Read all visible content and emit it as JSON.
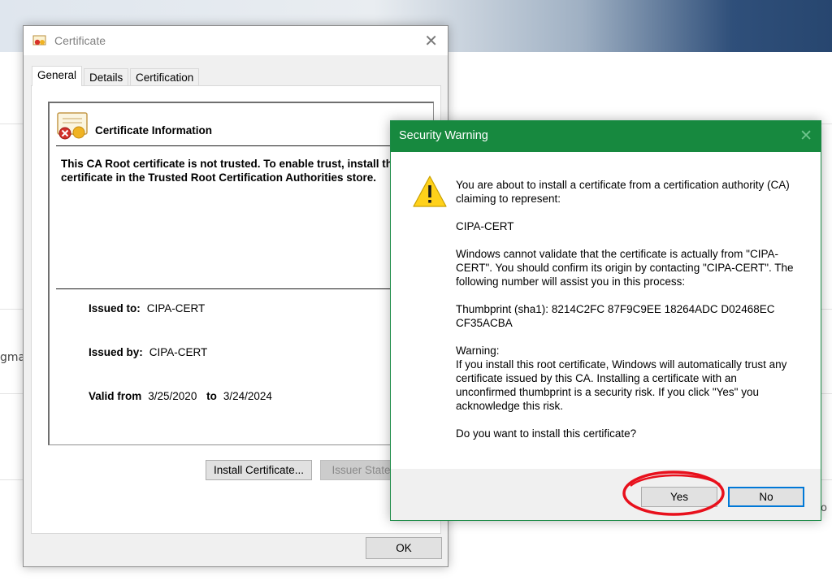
{
  "background": {
    "partial_text_left": "gma",
    "partial_text_right": "o"
  },
  "certificate_window": {
    "title": "Certificate",
    "close_glyph": "✕",
    "tabs": [
      {
        "label": "General",
        "active": true
      },
      {
        "label": "Details",
        "active": false
      },
      {
        "label": "Certification Path",
        "active": false
      }
    ],
    "info_heading": "Certificate Information",
    "message": "This CA Root certificate is not trusted. To enable trust, install this certificate in the Trusted Root Certification Authorities store.",
    "issued_to_label": "Issued to:",
    "issued_to_value": "CIPA-CERT",
    "issued_by_label": "Issued by:",
    "issued_by_value": "CIPA-CERT",
    "valid_from_label": "Valid from",
    "valid_from_value": "3/25/2020",
    "valid_to_label": "to",
    "valid_to_value": "3/24/2024",
    "install_button": "Install Certificate...",
    "issuer_statement_button": "Issuer Statement",
    "ok_button": "OK",
    "icons": {
      "title": "certificate-icon",
      "info": "untrusted-certificate-icon"
    }
  },
  "security_warning": {
    "title": "Security Warning",
    "close_glyph": "✕",
    "icon": "warning-icon",
    "intro": "You are about to install a certificate from a certification authority (CA) claiming to represent:",
    "ca_name": "CIPA-CERT",
    "validation_text": "Windows cannot validate that the certificate is actually from \"CIPA-CERT\". You should confirm its origin by contacting \"CIPA-CERT\". The following number will assist you in this process:",
    "thumbprint_label": "Thumbprint (sha1):",
    "thumbprint_value": "8214C2FC 87F9C9EE 18264ADC D02468EC CF35ACBA",
    "warning_label": "Warning:",
    "warning_text": "If you install this root certificate, Windows will automatically trust any certificate issued by this CA. Installing a certificate with an unconfirmed thumbprint is a security risk. If you click \"Yes\" you acknowledge this risk.",
    "question": "Do you want to install this certificate?",
    "yes_button": "Yes",
    "no_button": "No"
  },
  "colors": {
    "dialog_title_green": "#17893f",
    "default_button_blue": "#0078d7",
    "annotation_red": "#e8101c"
  }
}
